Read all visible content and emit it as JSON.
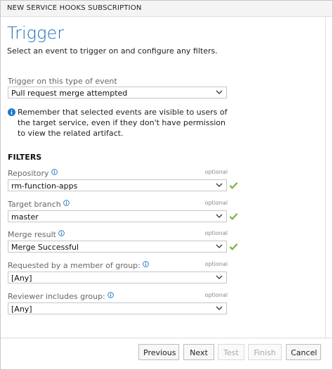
{
  "window": {
    "title": "NEW SERVICE HOOKS SUBSCRIPTION"
  },
  "header": {
    "title": "Trigger",
    "subtitle": "Select an event to trigger on and configure any filters."
  },
  "event": {
    "label": "Trigger on this type of event",
    "value": "Pull request merge attempted"
  },
  "notice": {
    "text": "Remember that selected events are visible to users of the target service, even if they don't have permission to view the related artifact."
  },
  "filters": {
    "heading": "FILTERS",
    "optional_label": "optional",
    "repository": {
      "label": "Repository",
      "value": "rm-function-apps"
    },
    "target_branch": {
      "label": "Target branch",
      "value": "master"
    },
    "merge_result": {
      "label": "Merge result",
      "value": "Merge Successful"
    },
    "requested_by": {
      "label": "Requested by a member of group:",
      "value": "[Any]"
    },
    "reviewer": {
      "label": "Reviewer includes group:",
      "value": "[Any]"
    }
  },
  "buttons": {
    "previous": "Previous",
    "next": "Next",
    "test": "Test",
    "finish": "Finish",
    "cancel": "Cancel"
  },
  "colors": {
    "accent": "#1f6fb5",
    "check": "#7cb342",
    "info": "#1f78c8"
  }
}
